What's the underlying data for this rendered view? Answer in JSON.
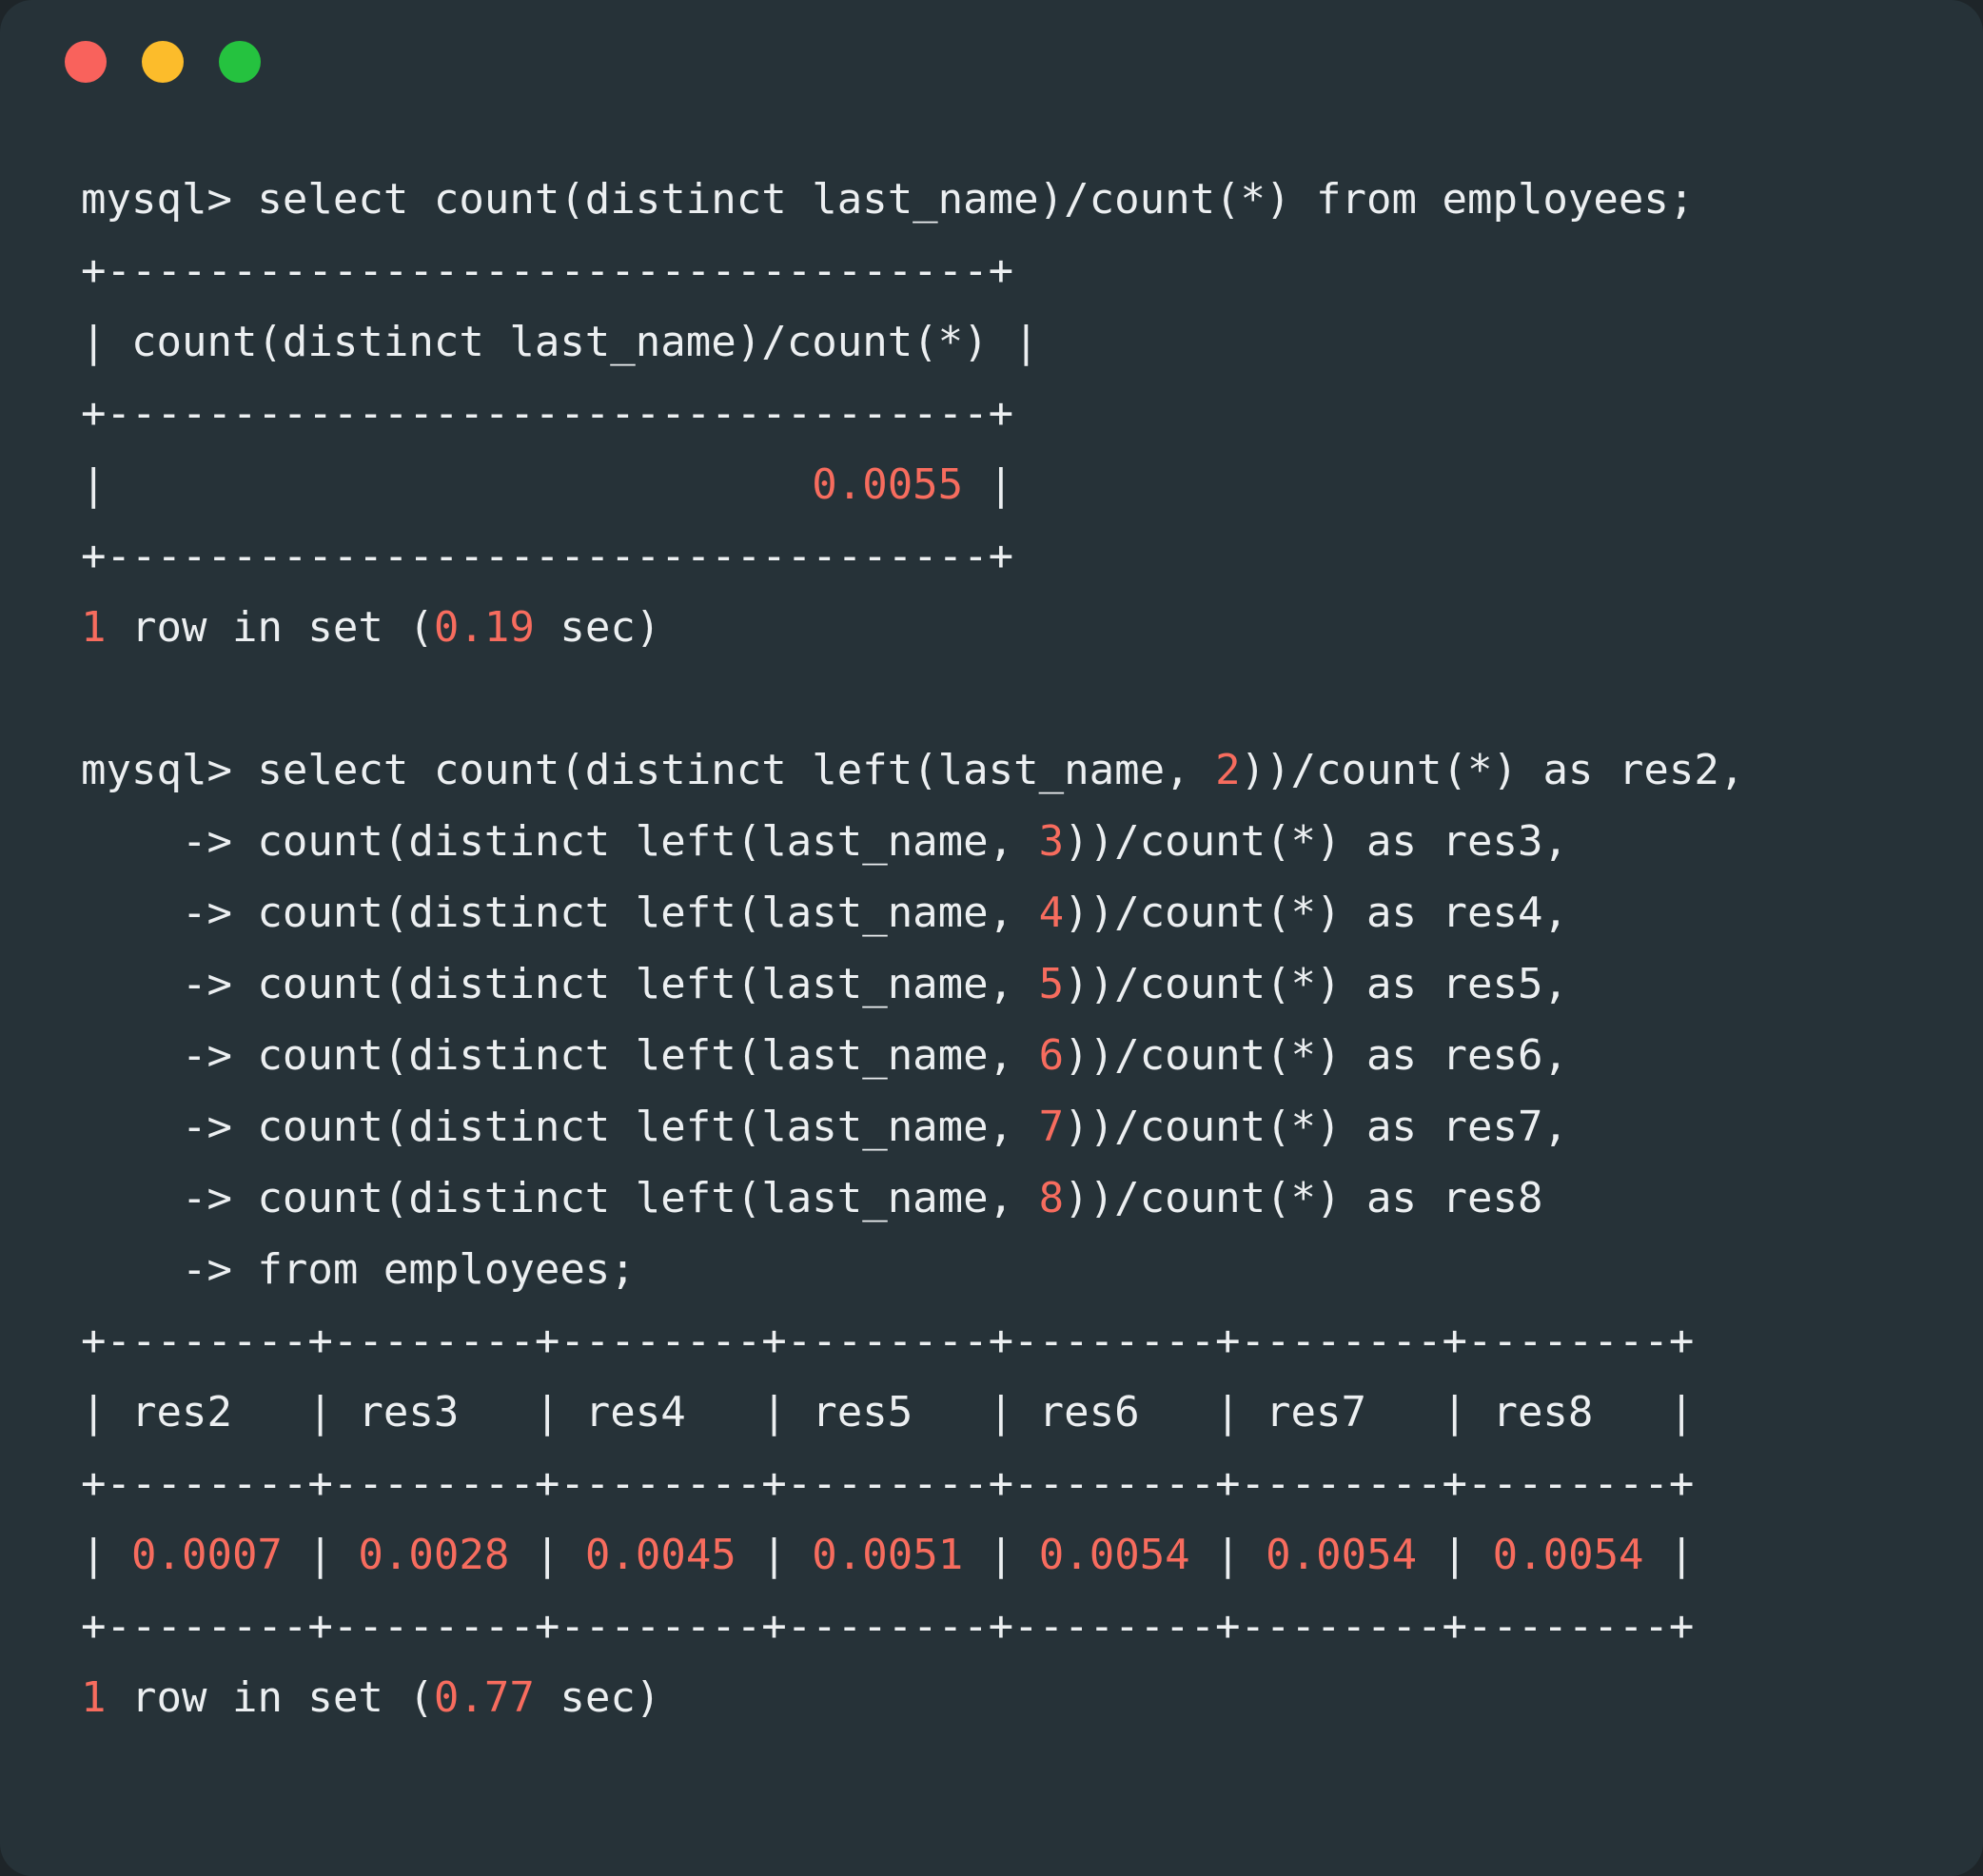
{
  "window": {
    "title": "mysql terminal",
    "background_color": "#263238",
    "page_background_color": "#1e2529",
    "text_color": "#eceff1",
    "number_color": "#f76c5e",
    "traffic_lights": [
      {
        "name": "close-button",
        "label": "Close",
        "color": "#f9625c"
      },
      {
        "name": "minimize-button",
        "label": "Minimize",
        "color": "#fcbc2b"
      },
      {
        "name": "maximize-button",
        "label": "Maximize",
        "color": "#25c23f"
      }
    ]
  },
  "console": {
    "lines": [
      {
        "type": "prompt",
        "segments": [
          {
            "t": "mysql> select count(distinct last_name)/count(*) from employees;",
            "c": "plain"
          }
        ]
      },
      {
        "type": "rule",
        "segments": [
          {
            "t": "+-----------------------------------+",
            "c": "plain"
          }
        ]
      },
      {
        "type": "header",
        "segments": [
          {
            "t": "| count(distinct last_name)/count(*) |",
            "c": "plain"
          }
        ]
      },
      {
        "type": "rule",
        "segments": [
          {
            "t": "+-----------------------------------+",
            "c": "plain"
          }
        ]
      },
      {
        "type": "row",
        "segments": [
          {
            "t": "|                            ",
            "c": "plain"
          },
          {
            "t": "0.0055",
            "c": "num"
          },
          {
            "t": " |",
            "c": "plain"
          }
        ]
      },
      {
        "type": "rule",
        "segments": [
          {
            "t": "+-----------------------------------+",
            "c": "plain"
          }
        ]
      },
      {
        "type": "status",
        "segments": [
          {
            "t": "1",
            "c": "num"
          },
          {
            "t": " row in set (",
            "c": "plain"
          },
          {
            "t": "0.19",
            "c": "num"
          },
          {
            "t": " sec)",
            "c": "plain"
          }
        ]
      },
      {
        "type": "blank",
        "segments": [
          {
            "t": " ",
            "c": "plain"
          }
        ]
      },
      {
        "type": "prompt",
        "segments": [
          {
            "t": "mysql> select count(distinct left(last_name, ",
            "c": "plain"
          },
          {
            "t": "2",
            "c": "num"
          },
          {
            "t": "))/count(*) as res2,",
            "c": "plain"
          }
        ]
      },
      {
        "type": "continuation",
        "segments": [
          {
            "t": "    -> count(distinct left(last_name, ",
            "c": "plain"
          },
          {
            "t": "3",
            "c": "num"
          },
          {
            "t": "))/count(*) as res3,",
            "c": "plain"
          }
        ]
      },
      {
        "type": "continuation",
        "segments": [
          {
            "t": "    -> count(distinct left(last_name, ",
            "c": "plain"
          },
          {
            "t": "4",
            "c": "num"
          },
          {
            "t": "))/count(*) as res4,",
            "c": "plain"
          }
        ]
      },
      {
        "type": "continuation",
        "segments": [
          {
            "t": "    -> count(distinct left(last_name, ",
            "c": "plain"
          },
          {
            "t": "5",
            "c": "num"
          },
          {
            "t": "))/count(*) as res5,",
            "c": "plain"
          }
        ]
      },
      {
        "type": "continuation",
        "segments": [
          {
            "t": "    -> count(distinct left(last_name, ",
            "c": "plain"
          },
          {
            "t": "6",
            "c": "num"
          },
          {
            "t": "))/count(*) as res6,",
            "c": "plain"
          }
        ]
      },
      {
        "type": "continuation",
        "segments": [
          {
            "t": "    -> count(distinct left(last_name, ",
            "c": "plain"
          },
          {
            "t": "7",
            "c": "num"
          },
          {
            "t": "))/count(*) as res7,",
            "c": "plain"
          }
        ]
      },
      {
        "type": "continuation",
        "segments": [
          {
            "t": "    -> count(distinct left(last_name, ",
            "c": "plain"
          },
          {
            "t": "8",
            "c": "num"
          },
          {
            "t": "))/count(*) as res8",
            "c": "plain"
          }
        ]
      },
      {
        "type": "continuation",
        "segments": [
          {
            "t": "    -> from employees;",
            "c": "plain"
          }
        ]
      },
      {
        "type": "rule",
        "segments": [
          {
            "t": "+--------+--------+--------+--------+--------+--------+--------+",
            "c": "plain"
          }
        ]
      },
      {
        "type": "header",
        "segments": [
          {
            "t": "| res2   | res3   | res4   | res5   | res6   | res7   | res8   |",
            "c": "plain"
          }
        ]
      },
      {
        "type": "rule",
        "segments": [
          {
            "t": "+--------+--------+--------+--------+--------+--------+--------+",
            "c": "plain"
          }
        ]
      },
      {
        "type": "row",
        "segments": [
          {
            "t": "| ",
            "c": "plain"
          },
          {
            "t": "0.0007",
            "c": "num"
          },
          {
            "t": " | ",
            "c": "plain"
          },
          {
            "t": "0.0028",
            "c": "num"
          },
          {
            "t": " | ",
            "c": "plain"
          },
          {
            "t": "0.0045",
            "c": "num"
          },
          {
            "t": " | ",
            "c": "plain"
          },
          {
            "t": "0.0051",
            "c": "num"
          },
          {
            "t": " | ",
            "c": "plain"
          },
          {
            "t": "0.0054",
            "c": "num"
          },
          {
            "t": " | ",
            "c": "plain"
          },
          {
            "t": "0.0054",
            "c": "num"
          },
          {
            "t": " | ",
            "c": "plain"
          },
          {
            "t": "0.0054",
            "c": "num"
          },
          {
            "t": " |",
            "c": "plain"
          }
        ]
      },
      {
        "type": "rule",
        "segments": [
          {
            "t": "+--------+--------+--------+--------+--------+--------+--------+",
            "c": "plain"
          }
        ]
      },
      {
        "type": "status",
        "segments": [
          {
            "t": "1",
            "c": "num"
          },
          {
            "t": " row in set (",
            "c": "plain"
          },
          {
            "t": "0.77",
            "c": "num"
          },
          {
            "t": " sec)",
            "c": "plain"
          }
        ]
      }
    ],
    "query_1": {
      "sql": "select count(distinct last_name)/count(*) from employees;",
      "column": "count(distinct last_name)/count(*)",
      "value": "0.0055",
      "rows": "1",
      "time": "0.19"
    },
    "query_2": {
      "sql": "select count(distinct left(last_name, N))/count(*) as resN ... from employees;",
      "columns": [
        "res2",
        "res3",
        "res4",
        "res5",
        "res6",
        "res7",
        "res8"
      ],
      "values": [
        "0.0007",
        "0.0028",
        "0.0045",
        "0.0051",
        "0.0054",
        "0.0054",
        "0.0054"
      ],
      "rows": "1",
      "time": "0.77"
    }
  }
}
